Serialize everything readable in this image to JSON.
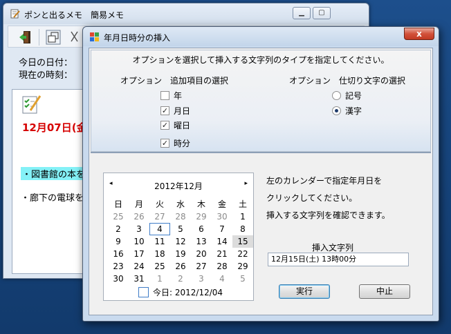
{
  "background_window": {
    "title": "ポンと出るメモ　簡易メモ",
    "labels": [
      "今日の日付：",
      "現在の時刻："
    ],
    "memo": {
      "date_text": "12月07日(金",
      "lines": [
        "・図書館の本を",
        "・廊下の電球を"
      ]
    }
  },
  "dialog": {
    "title": "年月日時分の挿入",
    "close_label": "x",
    "instruction": "オプションを選択して挿入する文字列のタイプを指定してください。",
    "options_label": "オプション　追加項目の選択",
    "separator_label": "オプション　仕切り文字の選択",
    "checkboxes": [
      {
        "label": "年",
        "checked": false
      },
      {
        "label": "月日",
        "checked": true
      },
      {
        "label": "曜日",
        "checked": true
      },
      {
        "label": "時分",
        "checked": true
      }
    ],
    "radios": [
      {
        "label": "記号",
        "selected": false
      },
      {
        "label": "漢字",
        "selected": true
      }
    ],
    "calendar": {
      "month_label": "2012年12月",
      "prev": "◂",
      "next": "▸",
      "weekdays": [
        "日",
        "月",
        "火",
        "水",
        "木",
        "金",
        "土"
      ],
      "weeks": [
        [
          "25",
          "26",
          "27",
          "28",
          "29",
          "30",
          "1"
        ],
        [
          "2",
          "3",
          "4",
          "5",
          "6",
          "7",
          "8"
        ],
        [
          "9",
          "10",
          "11",
          "12",
          "13",
          "14",
          "15"
        ],
        [
          "16",
          "17",
          "18",
          "19",
          "20",
          "21",
          "22"
        ],
        [
          "23",
          "24",
          "25",
          "26",
          "27",
          "28",
          "29"
        ],
        [
          "30",
          "31",
          "1",
          "2",
          "3",
          "4",
          "5"
        ]
      ],
      "today_day": "4",
      "selected_day": "15",
      "today_text": "今日: 2012/12/04"
    },
    "help_lines": [
      "左のカレンダーで指定年月日を",
      "クリックしてください。",
      "挿入する文字列を確認できます。"
    ],
    "field_label": "挿入文字列",
    "field_value": "12月15日(土) 13時00分",
    "ok_label": "実行",
    "cancel_label": "中止"
  }
}
